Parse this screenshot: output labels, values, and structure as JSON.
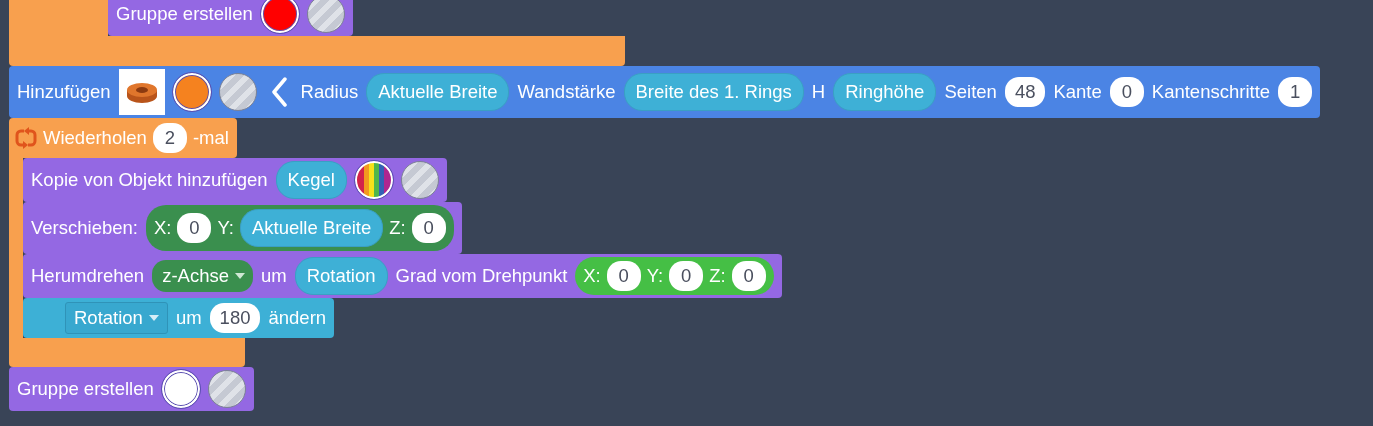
{
  "outer_loop": {
    "body": [
      {
        "kind": "modify",
        "parts": [
          {
            "kind": "text",
            "text": "Gruppe erstellen"
          },
          {
            "kind": "color",
            "color": "#ff0000"
          },
          {
            "kind": "hole"
          }
        ]
      }
    ]
  },
  "statements": [
    {
      "kind": "create",
      "parts": [
        {
          "kind": "text",
          "text": "Hinzufügen"
        },
        {
          "kind": "shape"
        },
        {
          "kind": "color",
          "color": "#f5821f"
        },
        {
          "kind": "hole"
        },
        {
          "kind": "chevron"
        },
        {
          "kind": "text",
          "text": "Radius"
        },
        {
          "kind": "var",
          "text": "Aktuelle Breite"
        },
        {
          "kind": "text",
          "text": "Wandstärke"
        },
        {
          "kind": "var",
          "text": "Breite des 1. Rings"
        },
        {
          "kind": "text",
          "text": "H"
        },
        {
          "kind": "var",
          "text": "Ringhöhe"
        },
        {
          "kind": "text",
          "text": "Seiten"
        },
        {
          "kind": "num",
          "text": "48"
        },
        {
          "kind": "text",
          "text": "Kante"
        },
        {
          "kind": "num",
          "text": "0"
        },
        {
          "kind": "text",
          "text": "Kantenschritte"
        },
        {
          "kind": "num",
          "text": "1"
        }
      ]
    },
    {
      "kind": "loop",
      "parts": [
        {
          "kind": "repeat"
        },
        {
          "kind": "text",
          "text": "Wiederholen"
        },
        {
          "kind": "num",
          "text": "2"
        },
        {
          "kind": "text",
          "text": "-mal"
        }
      ],
      "body": [
        {
          "kind": "modify",
          "parts": [
            {
              "kind": "text",
              "text": "Kopie von Objekt hinzufügen"
            },
            {
              "kind": "var",
              "text": "Kegel"
            },
            {
              "kind": "rainbow"
            },
            {
              "kind": "hole"
            }
          ]
        },
        {
          "kind": "modify",
          "parts": [
            {
              "kind": "text",
              "text": "Verschieben:"
            },
            {
              "kind": "xyz",
              "color": "#3a8f4e",
              "parts": [
                {
                  "kind": "text",
                  "text": "X:"
                },
                {
                  "kind": "num",
                  "text": "0"
                },
                {
                  "kind": "text",
                  "text": "Y:"
                },
                {
                  "kind": "var",
                  "text": "Aktuelle Breite"
                },
                {
                  "kind": "text",
                  "text": "Z:"
                },
                {
                  "kind": "num",
                  "text": "0"
                }
              ]
            }
          ]
        },
        {
          "kind": "modify",
          "parts": [
            {
              "kind": "text",
              "text": "Herumdrehen"
            },
            {
              "kind": "dropdown",
              "text": "z-Achse"
            },
            {
              "kind": "text",
              "text": "um"
            },
            {
              "kind": "var",
              "text": "Rotation"
            },
            {
              "kind": "text",
              "text": "Grad vom Drehpunkt"
            },
            {
              "kind": "xyz",
              "color": "#45bf45",
              "parts": [
                {
                  "kind": "text",
                  "text": "X:"
                },
                {
                  "kind": "num",
                  "text": "0"
                },
                {
                  "kind": "text",
                  "text": "Y:"
                },
                {
                  "kind": "num",
                  "text": "0"
                },
                {
                  "kind": "text",
                  "text": "Z:"
                },
                {
                  "kind": "num",
                  "text": "0"
                }
              ]
            }
          ]
        },
        {
          "kind": "math",
          "parts": [
            {
              "kind": "vardrop",
              "text": "Rotation"
            },
            {
              "kind": "text",
              "text": "um"
            },
            {
              "kind": "num",
              "text": "180"
            },
            {
              "kind": "text",
              "text": "ändern"
            }
          ]
        }
      ]
    },
    {
      "kind": "modify",
      "parts": [
        {
          "kind": "text",
          "text": "Gruppe erstellen"
        },
        {
          "kind": "color",
          "color": "#ffffff"
        },
        {
          "kind": "hole"
        }
      ]
    }
  ]
}
